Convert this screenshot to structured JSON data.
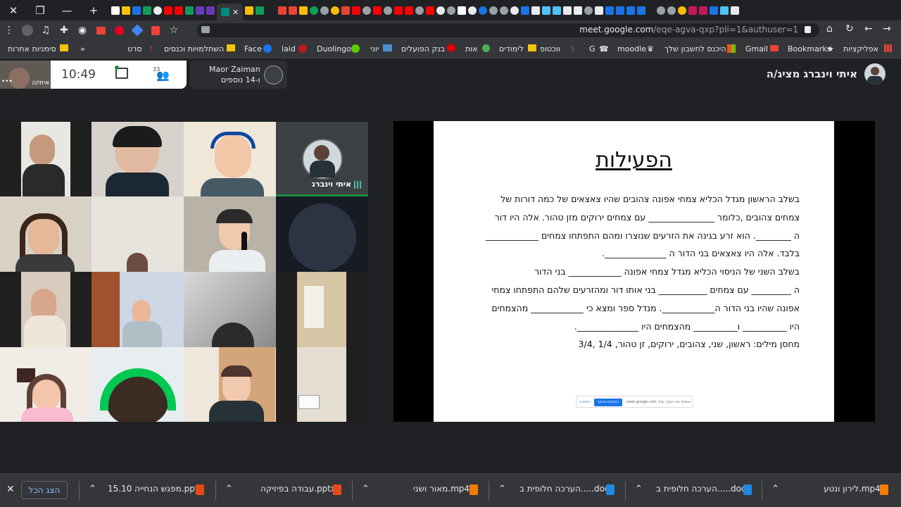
{
  "tabs": {
    "close_label": "✕",
    "new_label": "+"
  },
  "url": {
    "host": "meet.google.com",
    "path": "/eqe-agva-qxp?pli=1&authuser=1"
  },
  "bookmarks": [
    {
      "label": "אפליקציות"
    },
    {
      "label": "Bookmarks"
    },
    {
      "label": "Gmail"
    },
    {
      "label": "היכנס לחשבון שלך"
    },
    {
      "label": "moodle"
    },
    {
      "label": "G"
    },
    {
      "label": "S"
    },
    {
      "label": "ווכטופ"
    },
    {
      "label": "לימודים"
    },
    {
      "label": "אות"
    },
    {
      "label": "בנק הפועלים"
    },
    {
      "label": "יוני"
    },
    {
      "label": "Duolingo"
    },
    {
      "label": "laid"
    },
    {
      "label": "Face"
    },
    {
      "label": "השתלמויות וכנסים"
    },
    {
      "label": "סרט"
    },
    {
      "label": "סימניות אחרות"
    }
  ],
  "bookmarks_more": "»",
  "meet": {
    "clock": "10:49",
    "participants_count": "33",
    "self_label": "איתי/ה",
    "presenter_name": "Maor Zaiman",
    "presenter_more": "ו-14 נוספים",
    "presenting_label": "איתי וינברג מציג/ה",
    "tile_name": "איתי וינברג"
  },
  "slide": {
    "title": "הפעילות",
    "lines": [
      "בשלב הראשון מגדל הכליא צמחי אפונה צהובים שהיו צאצאים של כמה דורות של",
      "צמחים צהובים ,כלומר _______________ עם צמחים ירוקים מזן טהור. אלה היו דור",
      "ה ________. הוא זרע בגינה את הזרעים שנוצרו ומהם התפתחו צמחים ____________",
      "בלבד. אלה היו צאצאים בני הדור ה ______________.",
      "בשלב השני של הניסוי הכליא מגדל צמחי אפונה ____________ בני הדור",
      "ה _________ עם צמחים ___________ בני אותו דור ומהזרעים שלהם התפתחו צמחי",
      "אפונה שהיו בני הדור ה____________. מנדל ספר ומצא כי ____________ מהצמחים",
      "היו __________ ו__________ מהצמחים היו ______________.",
      "מחסן מילים: ראשון, שני, צהובים, ירוקים, זן טהור, 1/4 ,3/4"
    ],
    "share_bar": {
      "message": "meet.google.com משתף את המסך שלך",
      "stop": "הפסקת שיתוף",
      "hide": "הסתרה"
    }
  },
  "downloads": {
    "show_all": "הצג הכל",
    "items": [
      {
        "name": "לירון ונטע.mp4",
        "type": "vlc"
      },
      {
        "name": "הערכה חלופית ב.....docx",
        "type": "docx"
      },
      {
        "name": "הערכה חלופית ב.....docx",
        "type": "docx"
      },
      {
        "name": "מאור ושני.mp4",
        "type": "vlc"
      },
      {
        "name": "עבודה בפיזיקה.pptx",
        "type": "pptx"
      },
      {
        "name": "מפגש הנחייה 15.10.pptx",
        "type": "pptx"
      }
    ]
  },
  "colors": {
    "chrome_dark": "#202124",
    "chrome_mid": "#35363a",
    "meet_accent": "#8ab4f8",
    "speaking": "#1e8e3e"
  }
}
